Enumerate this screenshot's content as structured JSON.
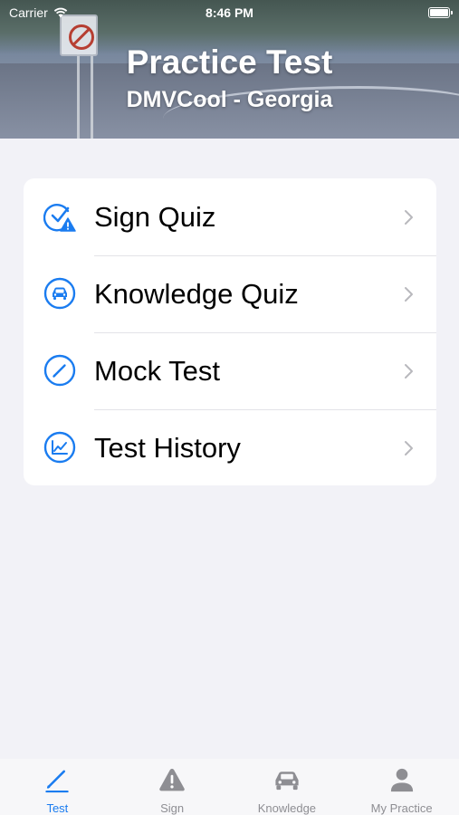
{
  "status_bar": {
    "carrier": "Carrier",
    "time": "8:46 PM"
  },
  "header": {
    "title": "Practice Test",
    "subtitle": "DMVCool - Georgia"
  },
  "menu": {
    "items": [
      {
        "label": "Sign Quiz",
        "icon": "checkmark-warning-icon"
      },
      {
        "label": "Knowledge Quiz",
        "icon": "car-circle-icon"
      },
      {
        "label": "Mock Test",
        "icon": "pencil-circle-icon"
      },
      {
        "label": "Test History",
        "icon": "chart-circle-icon"
      }
    ]
  },
  "tab_bar": {
    "tabs": [
      {
        "label": "Test",
        "icon": "pencil-icon",
        "active": true
      },
      {
        "label": "Sign",
        "icon": "warning-icon",
        "active": false
      },
      {
        "label": "Knowledge",
        "icon": "car-icon",
        "active": false
      },
      {
        "label": "My Practice",
        "icon": "person-icon",
        "active": false
      }
    ]
  },
  "colors": {
    "accent": "#1a7cf0",
    "inactive": "#8e8e93",
    "background": "#f2f2f7"
  }
}
